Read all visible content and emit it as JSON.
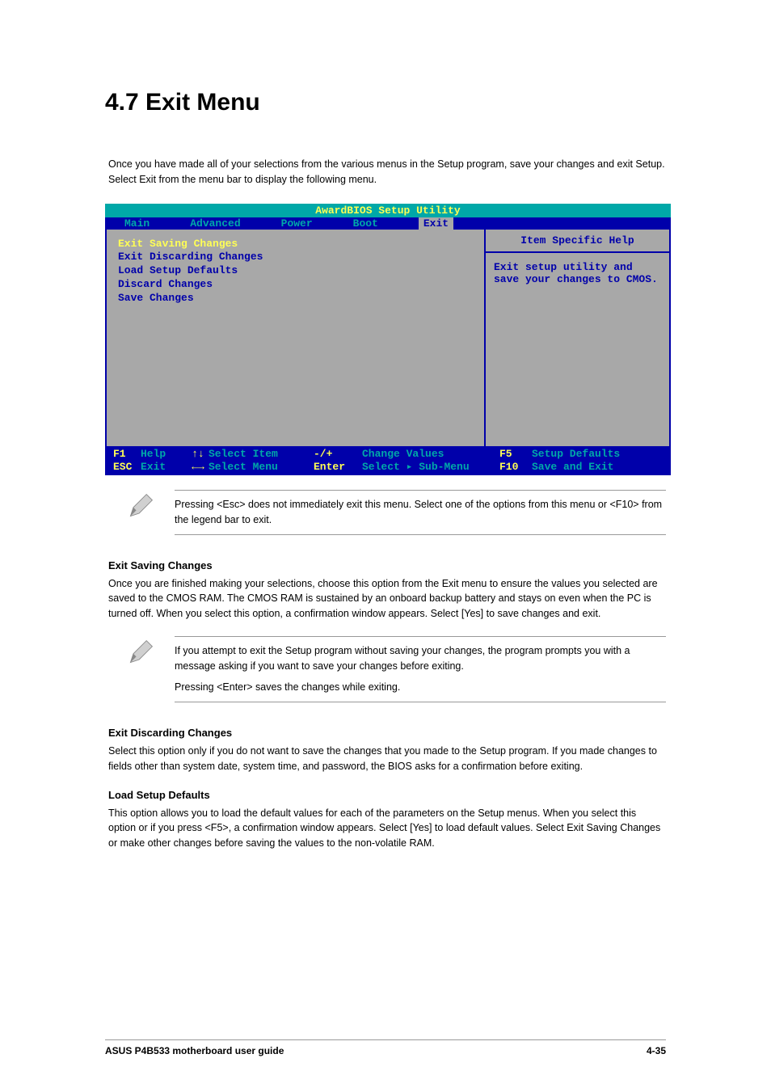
{
  "section_title": "4.7    Exit Menu",
  "intro": "Once you have made all of your selections from the various menus in the Setup program, save your changes and exit Setup. Select Exit from the menu bar to display the following menu.",
  "bios": {
    "utility_title": "AwardBIOS Setup Utility",
    "tabs": [
      "Main",
      "Advanced",
      "Power",
      "Boot",
      "Exit"
    ],
    "items": [
      "Exit Saving Changes",
      "Exit Discarding Changes",
      "Load Setup Defaults",
      "Discard Changes",
      "Save Changes"
    ],
    "help_title": "Item Specific Help",
    "help_body": "Exit setup utility and save your changes to CMOS.",
    "footer": {
      "r1": {
        "k1": "F1",
        "d1": "Help",
        "a1": "↑↓",
        "ac1": "Select Item",
        "mk": "-/+",
        "md": "Change Values",
        "rk": "F5",
        "rd": "Setup Defaults"
      },
      "r2": {
        "k1": "ESC",
        "d1": "Exit",
        "a1": "←→",
        "ac1": "Select Menu",
        "mk": "Enter",
        "md": "Select ▸ Sub-Menu",
        "rk": "F10",
        "rd": "Save and Exit"
      }
    }
  },
  "note1": "Pressing <Esc> does not immediately exit this menu. Select one of the options from this menu or <F10> from the legend bar to exit.",
  "sub1": {
    "title": "Exit Saving Changes",
    "body": "Once you are finished making your selections, choose this option from the Exit menu to ensure the values you selected are saved to the CMOS RAM. The CMOS RAM is sustained by an onboard backup battery and stays on even when the PC is turned off. When you select this option, a confirmation window appears. Select [Yes] to save changes and exit."
  },
  "note2_p1": "If you attempt to exit the Setup program without saving your changes, the program prompts you with a message asking if you want to save your changes before exiting.",
  "note2_p2": "Pressing <Enter> saves the changes while exiting.",
  "sub2": {
    "title": "Exit Discarding Changes",
    "body": "Select this option only if you do not want to save the changes that you made to the Setup program. If you made changes to fields other than system date, system time, and password, the BIOS asks for a confirmation before exiting."
  },
  "sub3": {
    "title": "Load Setup Defaults",
    "body": "This option allows you to load the default values for each of the parameters on the Setup menus. When you select this option or if you press <F5>, a confirmation window appears. Select [Yes] to load default values. Select Exit Saving Changes or make other changes before saving the values to the non-volatile RAM."
  },
  "footer": {
    "left": "ASUS P4B533 motherboard user guide",
    "right": "4-35"
  }
}
